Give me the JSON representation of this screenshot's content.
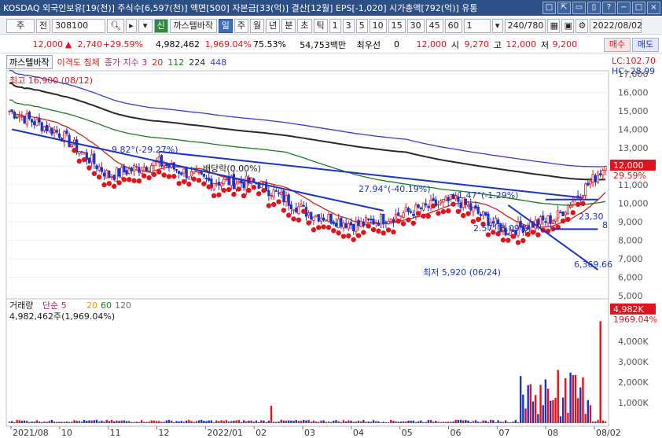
{
  "window": {
    "title": "KOSDAQ 외국인보유[19(천)] 주식수[6,597(천)] 액면[500] 자본금[33(억)] 결산[12월] EPS[-1,020] 시가총액[792(억)] 유통",
    "buttons": [
      "□",
      "⇱",
      "▭",
      "▯",
      "?",
      "−",
      "□",
      "×"
    ]
  },
  "toolbar": {
    "type_select": "주",
    "prev_label": "전",
    "code": "308100",
    "search_icon": "search-icon",
    "sound_icon": "speaker-icon",
    "name": "까스텔바작",
    "credit_badge": "신",
    "periods": [
      "일",
      "주",
      "월",
      "년",
      "분",
      "초",
      "틱"
    ],
    "active_period": "일",
    "intervals": [
      "1",
      "3",
      "5",
      "10",
      "15",
      "30",
      "45",
      "60"
    ],
    "interval_value": "1",
    "count": "240/780",
    "date": "2022/08/02"
  },
  "info": {
    "price": "12,000",
    "change": "2,740",
    "change_pct": "+29.59%",
    "volume": "4,982,462",
    "volume_pct": "1,969.04%",
    "turnover": "75.53%",
    "amount": "54,753백만",
    "priority": "최우선",
    "zero": "0",
    "ask": "12,000",
    "open_label": "시",
    "open": "9,270",
    "high_label": "고",
    "high": "12,000",
    "low_label": "저",
    "low": "9,200",
    "buy": "매수",
    "sell": "매도"
  },
  "legend": {
    "name": "까스텔바작",
    "overlay": "이격도 침체",
    "ma_label": "종가 지수 3",
    "ma_values": [
      "20",
      "112",
      "224",
      "448"
    ],
    "lc": "LC:102.70",
    "hc": "HC:-28.99"
  },
  "annotations": {
    "high_marker": "최고 16,900 (08/12)",
    "low_marker": "최저 5,920 (06/24)",
    "dividend": "배당락(0.00%)",
    "angle1": "9.82°(-29.27%)",
    "angle2": "27.94°(-40.19%)",
    "angle3": "-1.47°(-1.29%)",
    "angle4": "2.57°(3.09%)",
    "right1": "23,30",
    "right2": "8",
    "target": "6,369.66",
    "last_price": "12,000",
    "last_pct": "29.59%"
  },
  "volume_panel": {
    "label": "거래량",
    "ma_label": "단순 5",
    "ma_values": [
      "20",
      "60",
      "120"
    ],
    "value_text": "4,982,462주(1,969.04%)",
    "last_vol": "4,982K",
    "last_pct": "1969.04%"
  },
  "colors": {
    "up": "#e0141c",
    "down": "#1b33c8",
    "ma20": "#c6281c",
    "ma112": "#1f7a1f",
    "ma224": "#2a2a2a",
    "ma448": "#3b3bd0",
    "titlebar": "#2c4f86"
  },
  "chart_data": [
    {
      "type": "line",
      "title": "",
      "series": [
        {
          "name": "",
          "x": [
            "2021/08",
            "2021/09",
            "2021/10",
            "2021/11",
            "2021/12",
            "2022/01",
            "2022/02",
            "2022/03",
            "2022/04",
            "2022/05",
            "2022/06",
            "2022/07",
            "2022/08"
          ],
          "values": [
            15000,
            13800,
            11500,
            12200,
            11200,
            11100,
            9500,
            8800,
            9500,
            10200,
            8500,
            9200,
            12000
          ]
        }
      ],
      "y_ticks": [
        "17,000",
        "16,000",
        "15,000",
        "14,000",
        "13,000",
        "12,000",
        "11,000",
        "10,000",
        "9,000",
        "8,000",
        "7,000",
        "6,000",
        "5,000"
      ],
      "ylim": [
        5000,
        17000
      ]
    },
    {
      "type": "bar",
      "title": "",
      "categories": [
        "2021/08",
        "2022/01",
        "2022/06",
        "2022/07",
        "2022/08"
      ],
      "values": [
        150,
        850,
        2300,
        2600,
        4982
      ],
      "y_ticks": [
        "4,000K",
        "3,000K",
        "2,000K",
        "1,000K"
      ],
      "ylim": [
        0,
        5000
      ]
    }
  ],
  "x_axis": [
    "2021/08",
    "10",
    "11",
    "12",
    "2022/01",
    "02",
    "03",
    "04",
    "05",
    "06",
    "07",
    "08",
    "08/02"
  ]
}
